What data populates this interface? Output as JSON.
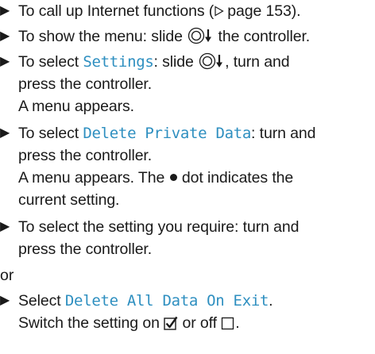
{
  "steps": [
    {
      "lines": [
        {
          "pre": "To call up Internet functions (",
          "ref_page": "page 153",
          "post": ")."
        }
      ]
    },
    {
      "lines": [
        {
          "pre": "To show the menu: slide ",
          "post": " the controller."
        }
      ]
    },
    {
      "lines": [
        {
          "pre": "To select ",
          "term": "Settings",
          "mid": ": slide ",
          "post": ", turn and"
        },
        {
          "text": "press the controller."
        },
        {
          "text": "A menu appears."
        }
      ]
    },
    {
      "lines": [
        {
          "pre": "To select ",
          "term": "Delete Private Data",
          "post": ": turn and"
        },
        {
          "text": "press the controller."
        },
        {
          "pre": "A menu appears. The ",
          "post": " dot indicates the"
        },
        {
          "text": "current setting."
        }
      ]
    },
    {
      "lines": [
        {
          "text": "To select the setting you require: turn and"
        },
        {
          "text": "press the controller."
        }
      ]
    }
  ],
  "or_text": "or",
  "final_step": {
    "lines": [
      {
        "pre": "Select ",
        "term": "Delete All Data On Exit",
        "post": "."
      },
      {
        "pre": "Switch the setting on ",
        "mid": " or off ",
        "post": "."
      }
    ]
  },
  "colors": {
    "menu_term": "#2e8fc0",
    "text": "#1a1a1a"
  },
  "icons": {
    "bullet": "right-triangle-bullet",
    "page_ref": "page-reference-triangle-icon",
    "controller": "controller-slide-down-icon",
    "option_dot": "selected-option-dot-icon",
    "checked": "checkbox-checked-icon",
    "unchecked": "checkbox-unchecked-icon"
  }
}
